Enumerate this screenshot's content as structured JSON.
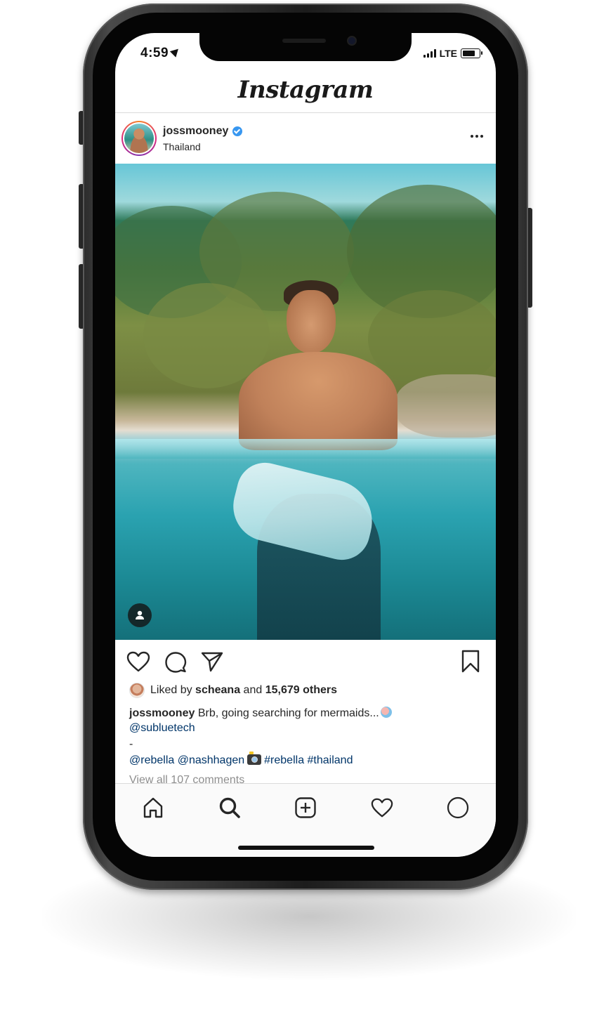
{
  "status_bar": {
    "time": "4:59",
    "network": "LTE",
    "battery_percent": 75
  },
  "app": {
    "logo_text": "Instagram"
  },
  "post": {
    "username": "jossmooney",
    "verified": true,
    "location": "Thailand",
    "likes": {
      "prefix": "Liked by",
      "liker": "scheana",
      "conjunction": "and",
      "count_text": "15,679 others"
    },
    "caption": {
      "author": "jossmooney",
      "text": "Brb, going searching for mermaids...",
      "mention_1": "@subluetech",
      "separator": "-",
      "mentions_2": "@rebella @nashhagen",
      "hashtags": "#rebella #thailand"
    },
    "view_comments": "View all 107 comments"
  },
  "icons": {
    "like": "heart-icon",
    "comment": "comment-icon",
    "share": "send-icon",
    "save": "bookmark-icon",
    "tag": "user-tag-icon",
    "more": "more-icon",
    "tab_home": "home-icon",
    "tab_search": "search-icon",
    "tab_add": "add-post-icon",
    "tab_activity": "heart-icon",
    "tab_profile": "profile-icon"
  },
  "colors": {
    "link": "#003569",
    "verified": "#3897f0",
    "muted": "#8e8e8e",
    "text": "#262626"
  }
}
